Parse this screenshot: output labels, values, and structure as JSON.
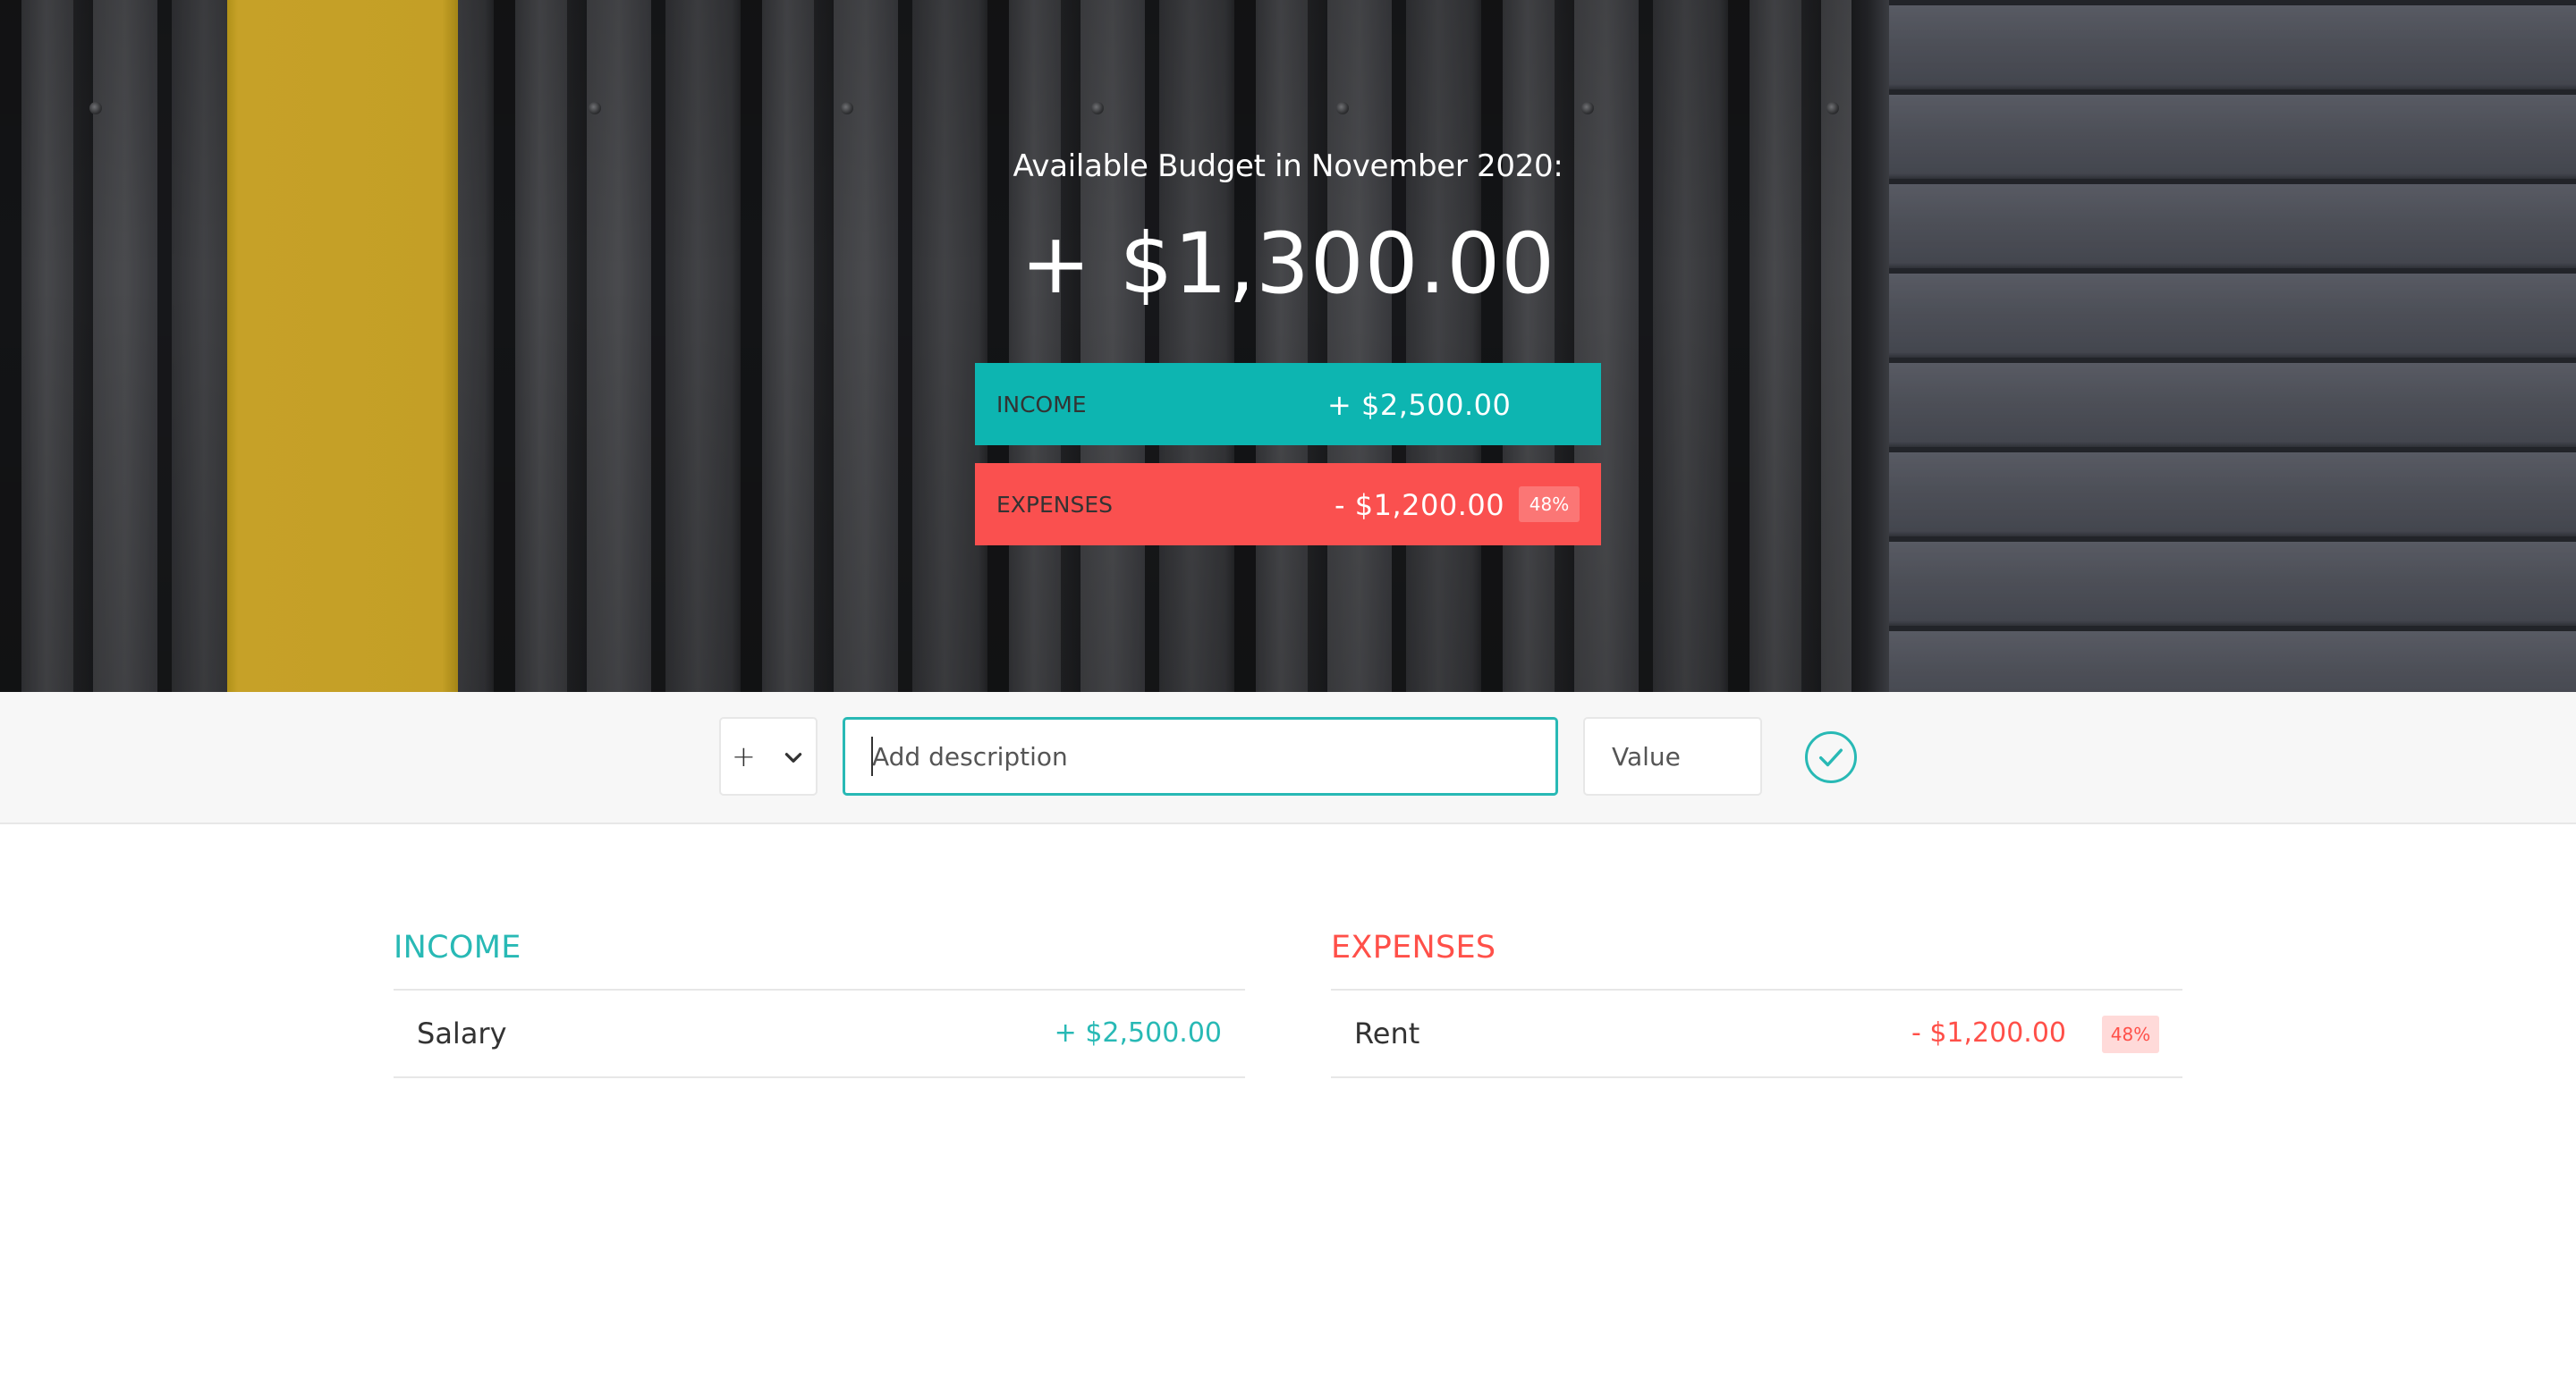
{
  "header": {
    "budget_title": "Available Budget in November 2020:",
    "budget_value": "+ $1,300.00",
    "income_label": "INCOME",
    "income_value": "+ $2,500.00",
    "expenses_label": "EXPENSES",
    "expenses_value": "- $1,200.00",
    "expenses_percentage": "48%"
  },
  "add_form": {
    "type_selected": "+",
    "description_placeholder": "Add description",
    "value_placeholder": "Value",
    "submit_icon": "checkmark-circle-icon"
  },
  "income_list": {
    "title": "INCOME",
    "items": [
      {
        "description": "Salary",
        "value": "+ $2,500.00"
      }
    ]
  },
  "expenses_list": {
    "title": "EXPENSES",
    "items": [
      {
        "description": "Rent",
        "value": "- $1,200.00",
        "percentage": "48%"
      }
    ]
  },
  "colors": {
    "income": "#28b9b5",
    "expenses": "#ff5049",
    "income_banner": "#0db5b1",
    "expenses_banner": "#fa504f"
  }
}
